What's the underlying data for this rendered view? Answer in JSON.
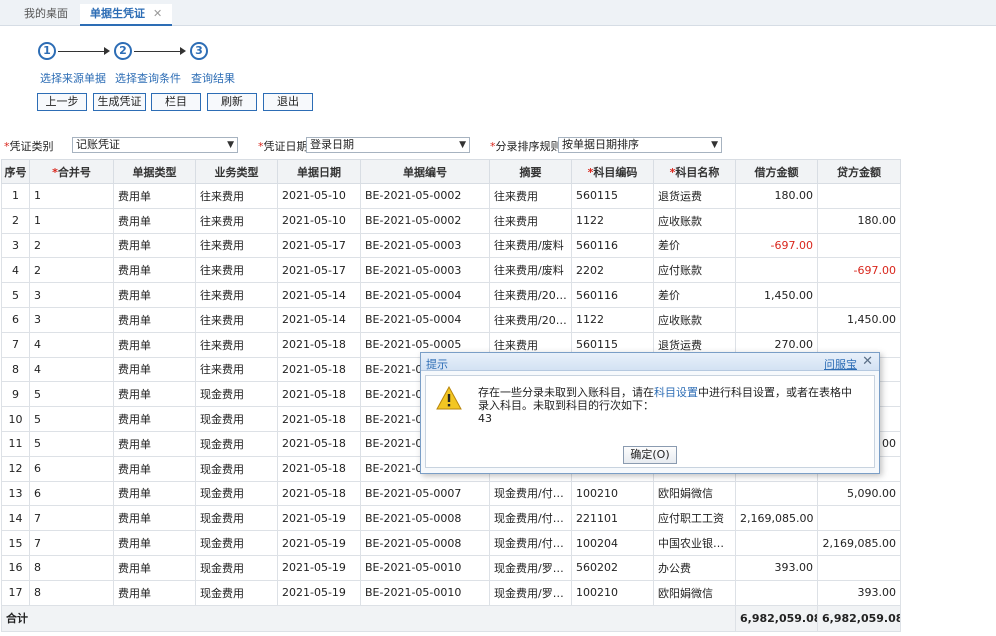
{
  "tabs": {
    "home": "我的桌面",
    "active": "单据生凭证",
    "close": "✕"
  },
  "steps": [
    {
      "num": "1",
      "label": "选择来源单据"
    },
    {
      "num": "2",
      "label": "选择查询条件"
    },
    {
      "num": "3",
      "label": "查询结果"
    }
  ],
  "toolbar": {
    "prev": "上一步",
    "generate": "生成凭证",
    "columns": "栏目",
    "refresh": "刷新",
    "exit": "退出"
  },
  "filters": {
    "voucher_type_label": "凭证类别",
    "voucher_type_value": "记账凭证",
    "voucher_date_label": "凭证日期",
    "voucher_date_value": "登录日期",
    "sort_label": "分录排序规则",
    "sort_value": "按单据日期排序",
    "required_mark": "*",
    "caret": "▼"
  },
  "table": {
    "headers": [
      "序号",
      "合并号",
      "单据类型",
      "业务类型",
      "单据日期",
      "单据编号",
      "摘要",
      "科目编码",
      "科目名称",
      "借方金额",
      "贷方金额"
    ],
    "rows": [
      [
        "1",
        "1",
        "费用单",
        "往来费用",
        "2021-05-10",
        "BE-2021-05-0002",
        "往来费用",
        "560115",
        "退货运费",
        "180.00",
        ""
      ],
      [
        "2",
        "1",
        "费用单",
        "往来费用",
        "2021-05-10",
        "BE-2021-05-0002",
        "往来费用",
        "1122",
        "应收账款",
        "",
        "180.00"
      ],
      [
        "3",
        "2",
        "费用单",
        "往来费用",
        "2021-05-17",
        "BE-2021-05-0003",
        "往来费用/废料",
        "560116",
        "差价",
        "-697.00",
        ""
      ],
      [
        "4",
        "2",
        "费用单",
        "往来费用",
        "2021-05-17",
        "BE-2021-05-0003",
        "往来费用/废料",
        "2202",
        "应付账款",
        "",
        "-697.00"
      ],
      [
        "5",
        "3",
        "费用单",
        "往来费用",
        "2021-05-14",
        "BE-2021-05-0004",
        "往来费用/20…",
        "560116",
        "差价",
        "1,450.00",
        ""
      ],
      [
        "6",
        "3",
        "费用单",
        "往来费用",
        "2021-05-14",
        "BE-2021-05-0004",
        "往来费用/20…",
        "1122",
        "应收账款",
        "",
        "1,450.00"
      ],
      [
        "7",
        "4",
        "费用单",
        "往来费用",
        "2021-05-18",
        "BE-2021-05-0005",
        "往来费用",
        "560115",
        "退货运费",
        "270.00",
        ""
      ],
      [
        "8",
        "4",
        "费用单",
        "往来费用",
        "2021-05-18",
        "BE-2021-05",
        "",
        "",
        "",
        "",
        ""
      ],
      [
        "9",
        "5",
        "费用单",
        "现金费用",
        "2021-05-18",
        "BE-2021-05",
        "",
        "",
        "",
        "",
        ""
      ],
      [
        "10",
        "5",
        "费用单",
        "现金费用",
        "2021-05-18",
        "BE-2021-05",
        "",
        "",
        "",
        "",
        ""
      ],
      [
        "11",
        "5",
        "费用单",
        "现金费用",
        "2021-05-18",
        "BE-2021-05",
        "",
        "",
        "",
        "",
        "00"
      ],
      [
        "12",
        "6",
        "费用单",
        "现金费用",
        "2021-05-18",
        "BE-2021-05",
        "",
        "",
        "",
        "",
        ""
      ],
      [
        "13",
        "6",
        "费用单",
        "现金费用",
        "2021-05-18",
        "BE-2021-05-0007",
        "现金费用/付…",
        "100210",
        "欧阳娟微信",
        "",
        "5,090.00"
      ],
      [
        "14",
        "7",
        "费用单",
        "现金费用",
        "2021-05-19",
        "BE-2021-05-0008",
        "现金费用/付…",
        "221101",
        "应付职工工资",
        "2,169,085.00",
        ""
      ],
      [
        "15",
        "7",
        "费用单",
        "现金费用",
        "2021-05-19",
        "BE-2021-05-0008",
        "现金费用/付…",
        "100204",
        "中国农业银…",
        "",
        "2,169,085.00"
      ],
      [
        "16",
        "8",
        "费用单",
        "现金费用",
        "2021-05-19",
        "BE-2021-05-0010",
        "现金费用/罗…",
        "560202",
        "办公费",
        "393.00",
        ""
      ],
      [
        "17",
        "8",
        "费用单",
        "现金费用",
        "2021-05-19",
        "BE-2021-05-0010",
        "现金费用/罗…",
        "100210",
        "欧阳娟微信",
        "",
        "393.00"
      ]
    ],
    "total_label": "合计",
    "total_debit": "6,982,059.08",
    "total_credit": "6,982,059.08"
  },
  "dialog": {
    "title": "提示",
    "help": "问服宝",
    "close": "✕",
    "msg_a": "存在一些分录未取到入账科目，请在",
    "msg_link": "科目设置",
    "msg_b": "中进行科目设置，或者在表格中录入科目。未取到科目的行次如下：",
    "rows": "43",
    "ok": "确定(O)"
  }
}
